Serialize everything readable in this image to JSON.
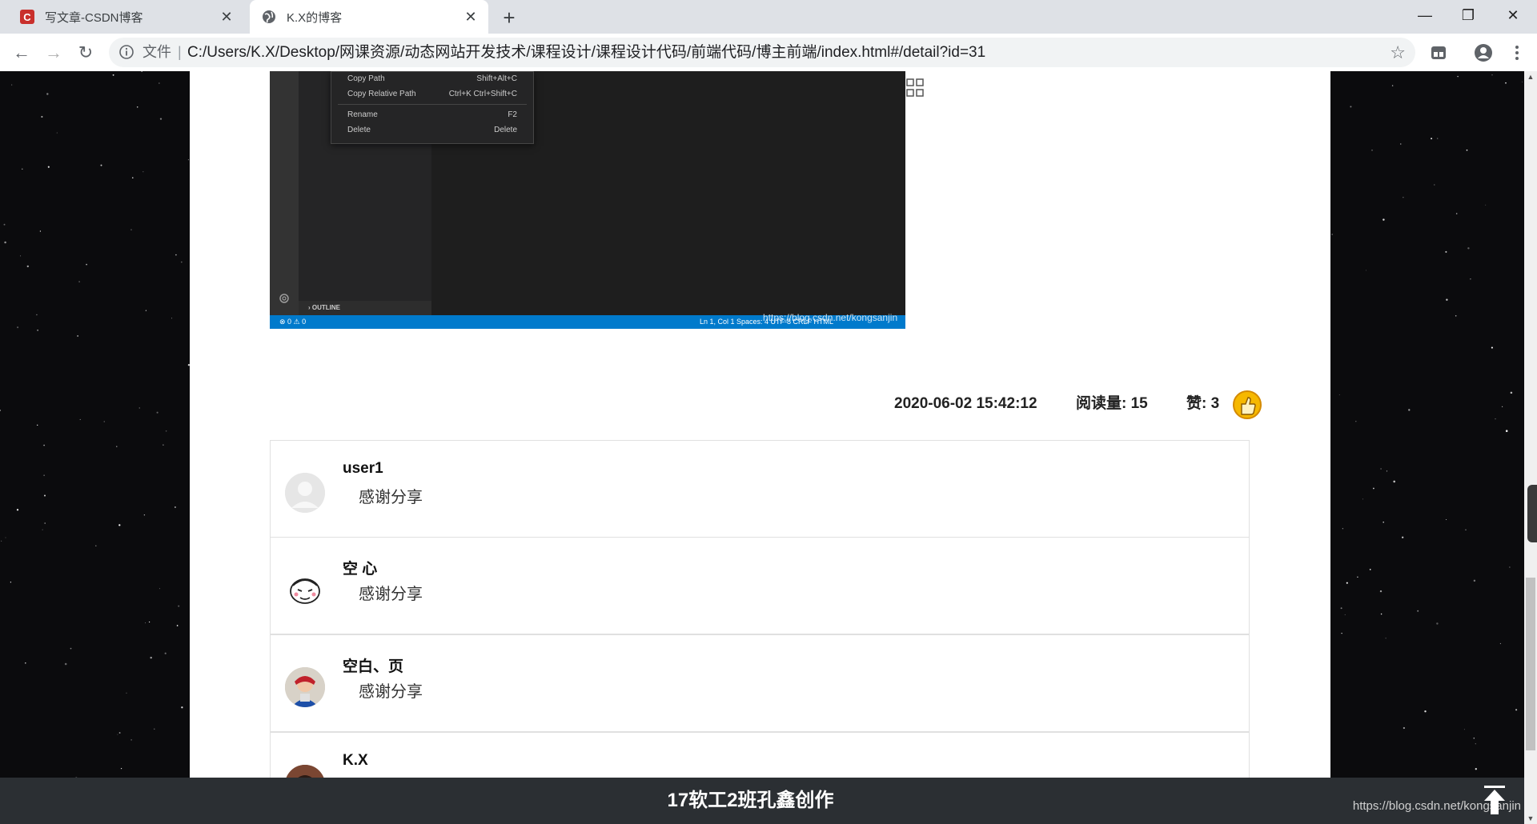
{
  "browser": {
    "tabs": [
      {
        "title": "写文章-CSDN博客",
        "active": false,
        "favicon": "csdn-icon"
      },
      {
        "title": "K.X的博客",
        "active": true,
        "favicon": "globe-icon"
      }
    ],
    "address": {
      "prefix": "文件",
      "url": "C:/Users/K.X/Desktop/网课资源/动态网站开发技术/课程设计/课程设计代码/前端代码/博主前端/index.html#/detail?id=31"
    }
  },
  "editor_screenshot": {
    "context_menu": [
      {
        "label": "Copy Path",
        "shortcut": "Shift+Alt+C"
      },
      {
        "label": "Copy Relative Path",
        "shortcut": "Ctrl+K Ctrl+Shift+C"
      },
      {
        "label": "Rename",
        "shortcut": "F2"
      },
      {
        "label": "Delete",
        "shortcut": "Delete"
      }
    ],
    "outline_label": "OUTLINE",
    "status_left": "⊗ 0 ⚠ 0",
    "status_right": "Ln 1, Col 1    Spaces: 4    UTF-8    CRLF    HTML",
    "watermark": "https://blog.csdn.net/kongsanjin"
  },
  "article_meta": {
    "date": "2020-06-02 15:42:12",
    "reads_label": "阅读量:",
    "reads": "15",
    "likes_label": "赞:",
    "likes": "3"
  },
  "comments": [
    {
      "user": "user1",
      "text": "感谢分享",
      "avatar": "default-avatar"
    },
    {
      "user": "空 心",
      "text": "感谢分享",
      "avatar": "sketch-face-avatar"
    },
    {
      "user": "空白、页",
      "text": "感谢分享",
      "avatar": "photo-avatar"
    },
    {
      "user": "K.X",
      "text": "",
      "avatar": "photo-avatar"
    }
  ],
  "footer": {
    "text": "17软工2班孔鑫创作",
    "watermark": "https://blog.csdn.net/kongsanjin"
  },
  "colors": {
    "accent": "#007acc",
    "csdn_red": "#c9302c",
    "footer_bg": "#2b2f33"
  }
}
